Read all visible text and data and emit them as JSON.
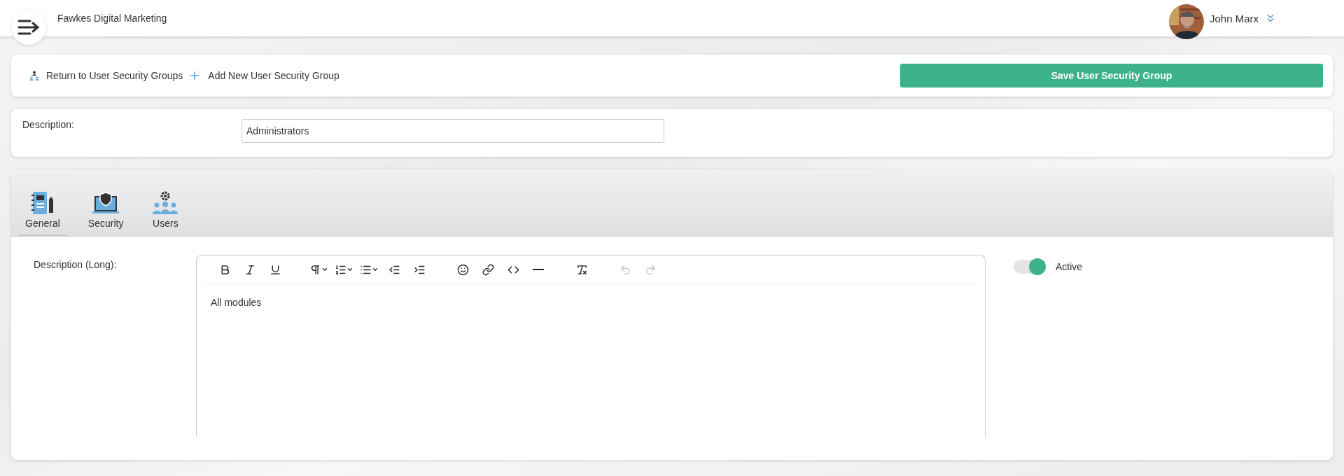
{
  "header": {
    "company": "Fawkes Digital Marketing",
    "user": {
      "name": "John Marx"
    }
  },
  "actions": {
    "links": [
      {
        "kind": "return",
        "label": "Return to User Security Groups"
      },
      {
        "kind": "add",
        "label": "Add New User Security Group"
      }
    ],
    "save_button": "Save User Security Group"
  },
  "description": {
    "label": "Description:",
    "value": "Administrators"
  },
  "tabs": [
    {
      "kind": "general",
      "label": "General",
      "selected": true
    },
    {
      "kind": "security",
      "label": "Security",
      "selected": false
    },
    {
      "kind": "users",
      "label": "Users",
      "selected": false
    }
  ],
  "general": {
    "long_label": "Description (Long):",
    "toolbar": [
      {
        "kind": "bold",
        "disabled": false
      },
      {
        "kind": "italic",
        "disabled": false
      },
      {
        "kind": "underline",
        "disabled": false
      },
      {
        "kind": "gap"
      },
      {
        "kind": "paragraph",
        "disabled": false
      },
      {
        "kind": "ordered-list",
        "disabled": false
      },
      {
        "kind": "bullet-list",
        "disabled": false
      },
      {
        "kind": "outdent",
        "disabled": false
      },
      {
        "kind": "indent",
        "disabled": false
      },
      {
        "kind": "gap"
      },
      {
        "kind": "emoji",
        "disabled": false
      },
      {
        "kind": "link",
        "disabled": false
      },
      {
        "kind": "code",
        "disabled": false
      },
      {
        "kind": "rule",
        "disabled": false
      },
      {
        "kind": "gap"
      },
      {
        "kind": "clear-format",
        "disabled": false
      },
      {
        "kind": "gap"
      },
      {
        "kind": "undo",
        "disabled": true
      },
      {
        "kind": "redo",
        "disabled": true
      }
    ],
    "body": "All modules",
    "active": {
      "label": "Active",
      "on": true
    }
  }
}
